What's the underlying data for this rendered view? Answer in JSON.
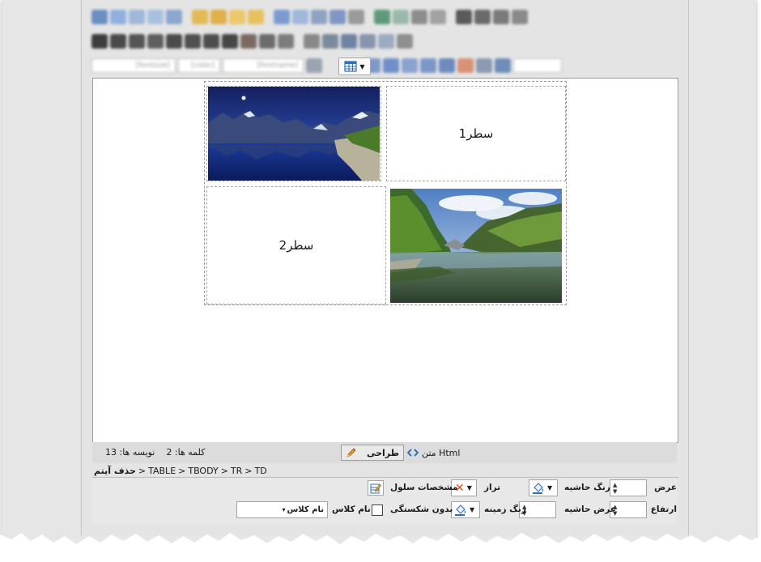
{
  "toolbar": {
    "font_size_placeholder": "[fontsize]",
    "font_color_placeholder": "[color]",
    "font_name_placeholder": "[fontname]"
  },
  "table": {
    "row1_label": "سطر1",
    "row2_label": "سطر2",
    "image_top_alt": "mountain lake at night",
    "image_bottom_alt": "fjord with green mountains"
  },
  "status": {
    "words_label": "کلمه ها: 2",
    "chars_label": "نویسه ها: 13",
    "design_label": "طراحی",
    "html_label": "متن Html"
  },
  "breadcrumb": {
    "remove_label": "حذف آیتم",
    "path": [
      "TABLE",
      "TBODY",
      "TR",
      "TD"
    ],
    "separator": ">"
  },
  "cell_props": {
    "width_label": "عرض",
    "height_label": "ارتفاع",
    "border_color_label": "رنگ حاشیه",
    "border_width_label": "عرض حاشیه",
    "align_label": "تراز",
    "bg_color_label": "رنگ زمینه",
    "cell_props_label": "مشخصات سلول",
    "nowrap_label": "بدون شکستگی",
    "class_label": "نام کلاس",
    "class_select_value": "نام کلاس"
  },
  "colors": {
    "accent_red": "#e0491f",
    "accent_blue": "#2f6fb9",
    "panel_gray": "#e4e4e4"
  }
}
